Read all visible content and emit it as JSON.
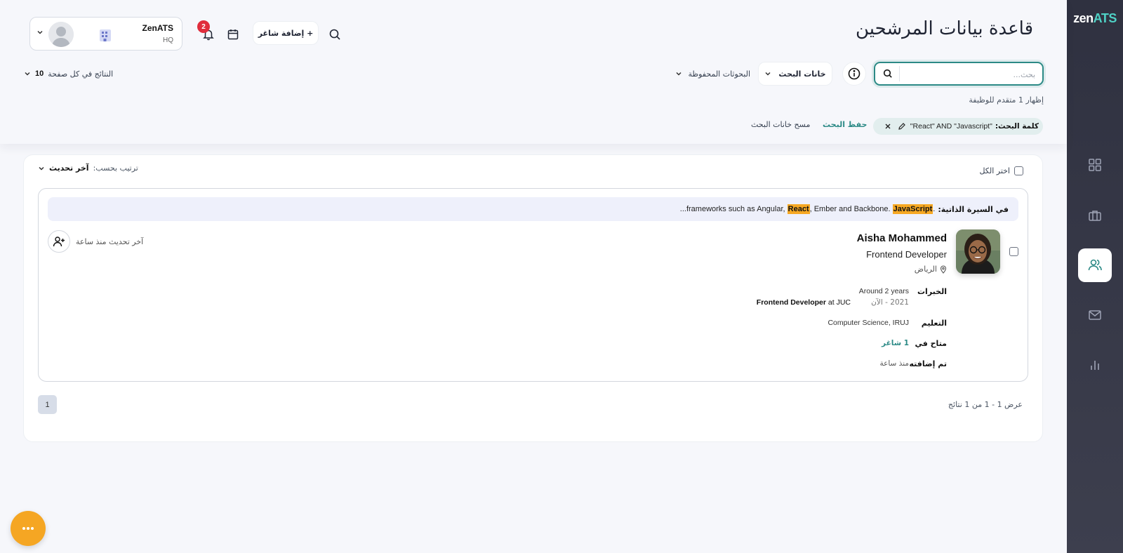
{
  "brand": {
    "logo_prefix": "zen",
    "logo_suffix": "ATS"
  },
  "sidebar": {
    "items": [
      {
        "icon": "grid-icon",
        "active": false
      },
      {
        "icon": "briefcase-icon",
        "active": false
      },
      {
        "icon": "users-icon",
        "active": true
      },
      {
        "icon": "mail-icon",
        "active": false
      },
      {
        "icon": "bar-chart-icon",
        "active": false
      }
    ]
  },
  "header": {
    "title": "قاعدة بيانات المرشحين",
    "add_talent_label": "+ إضافة شاغر",
    "notifications_count": "2",
    "user": {
      "org": "ZenATS",
      "branch": "HQ"
    }
  },
  "search": {
    "placeholder": "بحث...",
    "value": "",
    "filters_label": "خانات البحث",
    "saved_label": "البحوثات المحفوظة",
    "per_page_label": "النتائج في كل صفحة",
    "per_page_value": "10",
    "showing_text": "إظهار 1 متقدم للوظيفة",
    "chip_key": "كلمة البحث:",
    "chip_value": "\"React\" AND \"Javascript\"",
    "save_search_label": "حفظ البحث",
    "clear_filters_label": "مسح خانات البحث"
  },
  "list": {
    "select_all_label": "اختر الكل",
    "sort_label": "ترتيب بحسب:",
    "sort_value": "آخر تحديث"
  },
  "candidate": {
    "snippet_label": "في السيرة الذاتية:",
    "snippet_prefix": "...",
    "snippet_part1": "frameworks such as Angular, ",
    "snippet_hl1": "React",
    "snippet_part2": ", Ember and Backbone.",
    "snippet_hl2": "JavaScript",
    "snippet_end": ".",
    "name": "Aisha Mohammed",
    "role": "Frontend Developer",
    "location": "الرياض",
    "updated": "آخر تحديث منذ ساعة",
    "experience_label": "الخبرات",
    "experience_duration": "Around 2 years",
    "experience_period": "2021 - الآن",
    "experience_title": "Frontend Developer",
    "experience_company": " at JUC",
    "education_label": "التعليم",
    "education_value": "Computer Science, IRUJ",
    "available_label": "متاح في",
    "available_value": "1 شاغر",
    "added_label": "تم إضافته",
    "added_value": "منذ ساعة"
  },
  "pagination": {
    "current_page": "1",
    "info": "عرض 1 - 1 من 1 نتائج"
  },
  "colors": {
    "accent": "#2c8a86",
    "highlight": "#f6a823",
    "badge": "#e02d3c",
    "fab": "#f5a623",
    "sidebar": "#2f3140"
  }
}
